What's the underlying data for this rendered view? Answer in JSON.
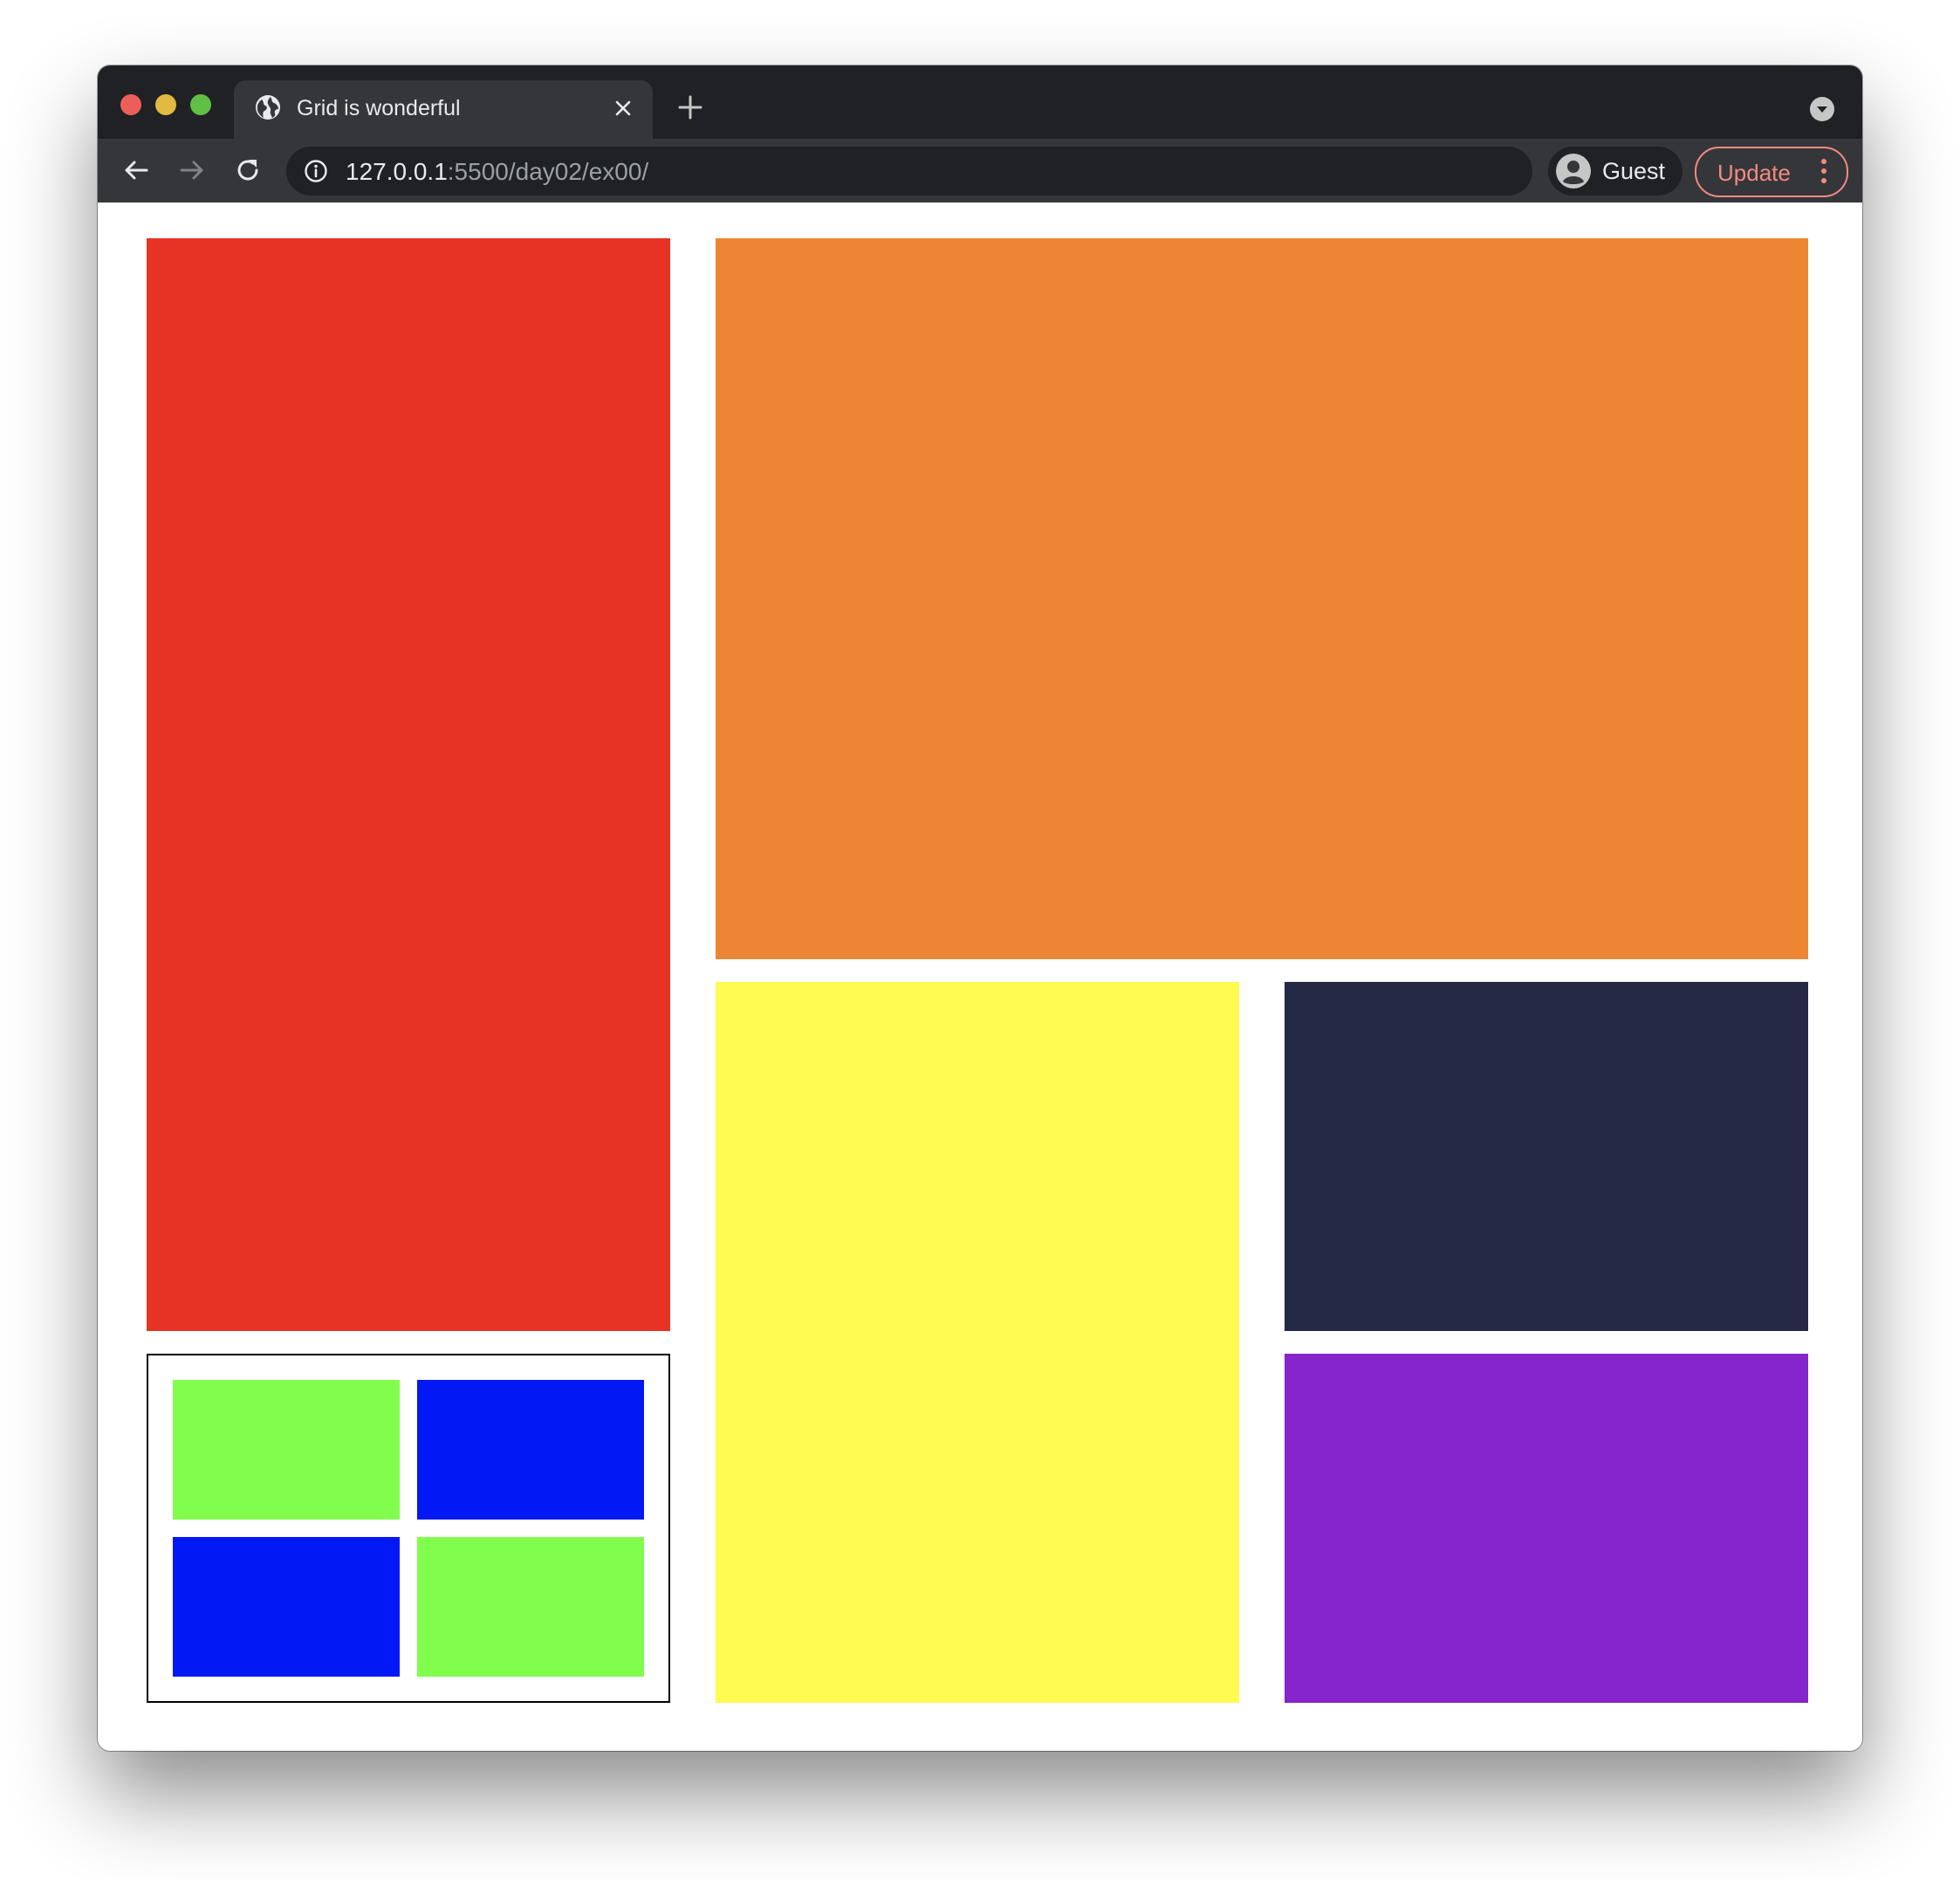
{
  "browser": {
    "tab": {
      "title": "Grid is wonderful",
      "icon": "globe-icon"
    },
    "address_bar": {
      "host": "127.0.0.1",
      "path": ":5500/day02/ex00/"
    },
    "profile": {
      "label": "Guest",
      "icon": "avatar-icon"
    },
    "update": {
      "label": "Update"
    }
  },
  "page": {
    "blocks": {
      "red": "#e63325",
      "orange": "#ec8633",
      "yellow": "#fffb51",
      "navy": "#242945",
      "purple": "#8625cb"
    },
    "nested_grid": {
      "cells": [
        "#80fe4b",
        "#0219f5",
        "#0219f5",
        "#80fe4b"
      ]
    }
  }
}
